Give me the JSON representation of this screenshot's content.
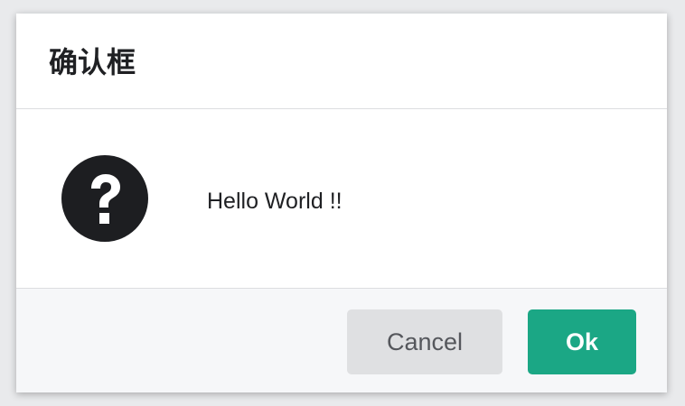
{
  "dialog": {
    "title": "确认框",
    "message": "Hello World !!",
    "icon": "question-circle-icon",
    "buttons": {
      "cancel_label": "Cancel",
      "ok_label": "Ok"
    },
    "colors": {
      "ok_background": "#1ba785",
      "cancel_background": "#dfe0e2",
      "footer_background": "#f6f7f9"
    }
  }
}
